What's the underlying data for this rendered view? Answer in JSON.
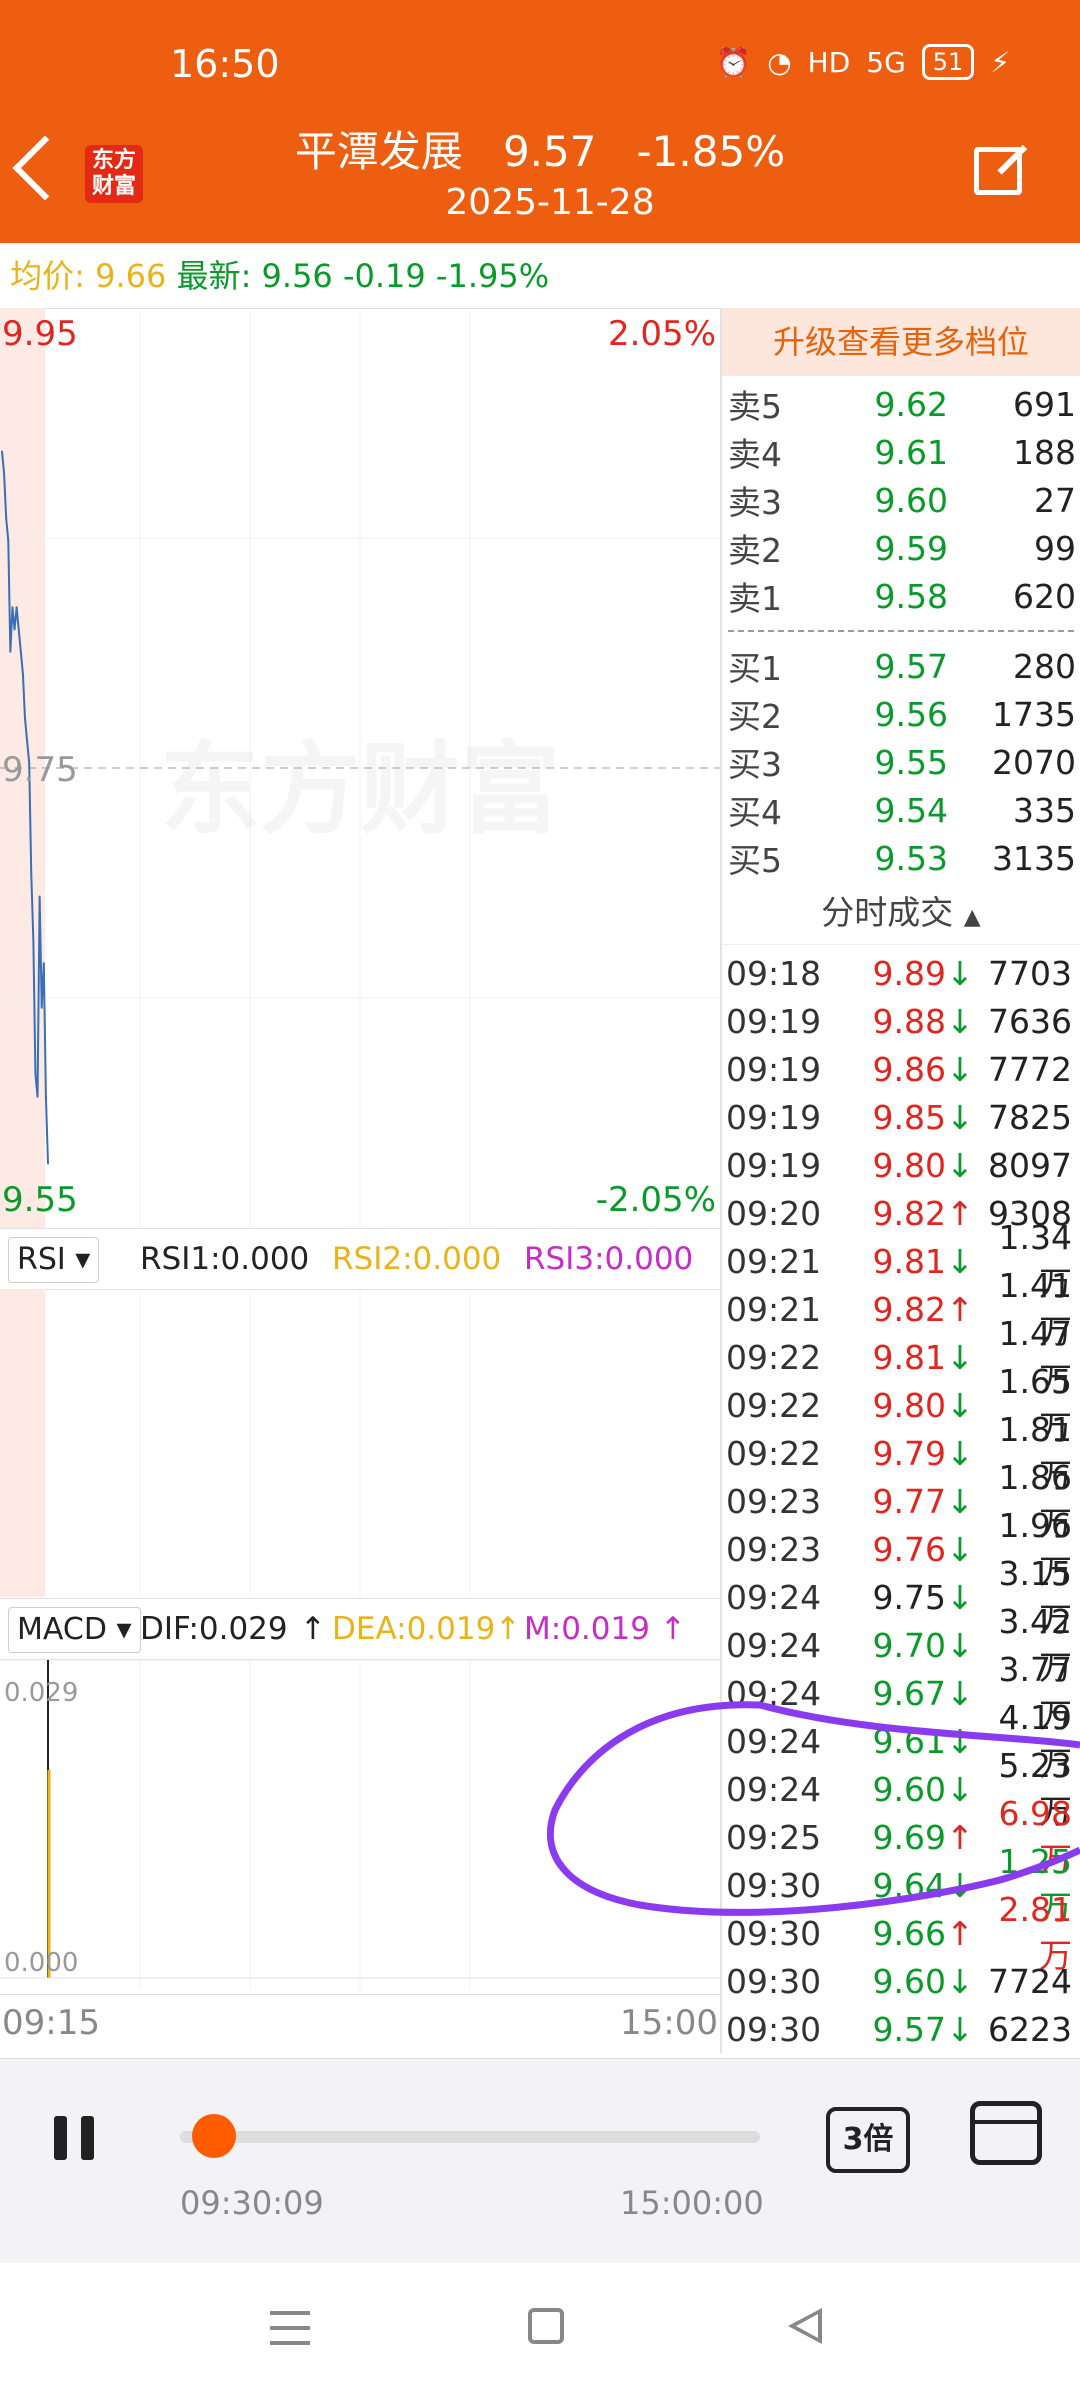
{
  "status": {
    "time": "16:50",
    "signal": "5G",
    "hd": "HD",
    "battery": "51"
  },
  "header": {
    "logo": "东方财富",
    "stock_name": "平潭发展",
    "price": "9.57",
    "change_pct": "-1.85%",
    "date": "2025-11-28"
  },
  "info": {
    "avg_label": "均价:",
    "avg_value": "9.66",
    "latest_label": "最新:",
    "latest_value": "9.56",
    "latest_change": "-0.19",
    "latest_pct": "-1.95%"
  },
  "chart": {
    "price_high": "9.95",
    "price_mid": "9.75",
    "price_low": "9.55",
    "pct_high": "2.05%",
    "pct_low": "-2.05%",
    "watermark": "东方财富",
    "time_start": "09:15",
    "time_end": "15:00"
  },
  "rsi": {
    "selector": "RSI",
    "rsi1": "RSI1:0.000",
    "rsi2": "RSI2:0.000",
    "rsi3": "RSI3:0.000"
  },
  "macd": {
    "selector": "MACD",
    "dif": "DIF:0.029",
    "dea": "DEA:0.019",
    "m": "M:0.019",
    "top": "0.029",
    "bottom": "0.000"
  },
  "chart_data": {
    "type": "line",
    "xlabel": "",
    "ylabel": "",
    "ylim": [
      9.55,
      9.95
    ],
    "x": [
      "09:18",
      "09:19",
      "09:19",
      "09:19",
      "09:19",
      "09:20",
      "09:21",
      "09:21",
      "09:22",
      "09:22",
      "09:22",
      "09:23",
      "09:23",
      "09:24",
      "09:24",
      "09:24",
      "09:24",
      "09:24",
      "09:25",
      "09:30",
      "09:30",
      "09:30",
      "09:30"
    ],
    "series": [
      {
        "values": [
          9.89,
          9.88,
          9.86,
          9.85,
          9.8,
          9.82,
          9.81,
          9.82,
          9.81,
          9.8,
          9.79,
          9.77,
          9.76,
          9.75,
          9.7,
          9.67,
          9.61,
          9.6,
          9.69,
          9.64,
          9.66,
          9.6,
          9.57
        ]
      }
    ]
  },
  "orderbook": {
    "upgrade_label": "升级查看更多档位",
    "asks": [
      {
        "label": "卖5",
        "price": "9.62",
        "vol": "691"
      },
      {
        "label": "卖4",
        "price": "9.61",
        "vol": "188"
      },
      {
        "label": "卖3",
        "price": "9.60",
        "vol": "27"
      },
      {
        "label": "卖2",
        "price": "9.59",
        "vol": "99"
      },
      {
        "label": "卖1",
        "price": "9.58",
        "vol": "620"
      }
    ],
    "bids": [
      {
        "label": "买1",
        "price": "9.57",
        "vol": "280"
      },
      {
        "label": "买2",
        "price": "9.56",
        "vol": "1735"
      },
      {
        "label": "买3",
        "price": "9.55",
        "vol": "2070"
      },
      {
        "label": "买4",
        "price": "9.54",
        "vol": "335"
      },
      {
        "label": "买5",
        "price": "9.53",
        "vol": "3135"
      }
    ]
  },
  "ticks": {
    "header": "分时成交",
    "rows": [
      {
        "time": "09:18",
        "price": "9.89",
        "dir": "down",
        "vol": "7703",
        "pc": "red",
        "vc": "dark"
      },
      {
        "time": "09:19",
        "price": "9.88",
        "dir": "down",
        "vol": "7636",
        "pc": "red",
        "vc": "dark"
      },
      {
        "time": "09:19",
        "price": "9.86",
        "dir": "down",
        "vol": "7772",
        "pc": "red",
        "vc": "dark"
      },
      {
        "time": "09:19",
        "price": "9.85",
        "dir": "down",
        "vol": "7825",
        "pc": "red",
        "vc": "dark"
      },
      {
        "time": "09:19",
        "price": "9.80",
        "dir": "down",
        "vol": "8097",
        "pc": "red",
        "vc": "dark"
      },
      {
        "time": "09:20",
        "price": "9.82",
        "dir": "up",
        "vol": "9308",
        "pc": "red",
        "vc": "dark"
      },
      {
        "time": "09:21",
        "price": "9.81",
        "dir": "down",
        "vol": "1.34万",
        "pc": "red",
        "vc": "dark"
      },
      {
        "time": "09:21",
        "price": "9.82",
        "dir": "up",
        "vol": "1.41万",
        "pc": "red",
        "vc": "dark"
      },
      {
        "time": "09:22",
        "price": "9.81",
        "dir": "down",
        "vol": "1.47万",
        "pc": "red",
        "vc": "dark"
      },
      {
        "time": "09:22",
        "price": "9.80",
        "dir": "down",
        "vol": "1.65万",
        "pc": "red",
        "vc": "dark"
      },
      {
        "time": "09:22",
        "price": "9.79",
        "dir": "down",
        "vol": "1.81万",
        "pc": "red",
        "vc": "dark"
      },
      {
        "time": "09:23",
        "price": "9.77",
        "dir": "down",
        "vol": "1.86万",
        "pc": "red",
        "vc": "dark"
      },
      {
        "time": "09:23",
        "price": "9.76",
        "dir": "down",
        "vol": "1.96万",
        "pc": "red",
        "vc": "dark"
      },
      {
        "time": "09:24",
        "price": "9.75",
        "dir": "down",
        "vol": "3.15万",
        "pc": "dark",
        "vc": "dark"
      },
      {
        "time": "09:24",
        "price": "9.70",
        "dir": "down",
        "vol": "3.42万",
        "pc": "green",
        "vc": "dark"
      },
      {
        "time": "09:24",
        "price": "9.67",
        "dir": "down",
        "vol": "3.77万",
        "pc": "green",
        "vc": "dark"
      },
      {
        "time": "09:24",
        "price": "9.61",
        "dir": "down",
        "vol": "4.19万",
        "pc": "green",
        "vc": "dark"
      },
      {
        "time": "09:24",
        "price": "9.60",
        "dir": "down",
        "vol": "5.23万",
        "pc": "green",
        "vc": "dark"
      },
      {
        "time": "09:25",
        "price": "9.69",
        "dir": "up",
        "vol": "6.98万",
        "pc": "green",
        "vc": "red"
      },
      {
        "time": "09:30",
        "price": "9.64",
        "dir": "down",
        "vol": "1.25万",
        "pc": "green",
        "vc": "green"
      },
      {
        "time": "09:30",
        "price": "9.66",
        "dir": "up",
        "vol": "2.81万",
        "pc": "green",
        "vc": "red"
      },
      {
        "time": "09:30",
        "price": "9.60",
        "dir": "down",
        "vol": "7724",
        "pc": "green",
        "vc": "dark"
      },
      {
        "time": "09:30",
        "price": "9.57",
        "dir": "down",
        "vol": "6223",
        "pc": "green",
        "vc": "dark"
      }
    ]
  },
  "playback": {
    "current_time": "09:30:09",
    "end_time": "15:00:00",
    "progress": 0.0,
    "speed": "3倍"
  },
  "colors": {
    "header_bg": "#ee5e10",
    "up": "#e0261f",
    "down": "#0a9a2a",
    "line": "#3a6fb8",
    "annotation": "#8a3bef"
  }
}
